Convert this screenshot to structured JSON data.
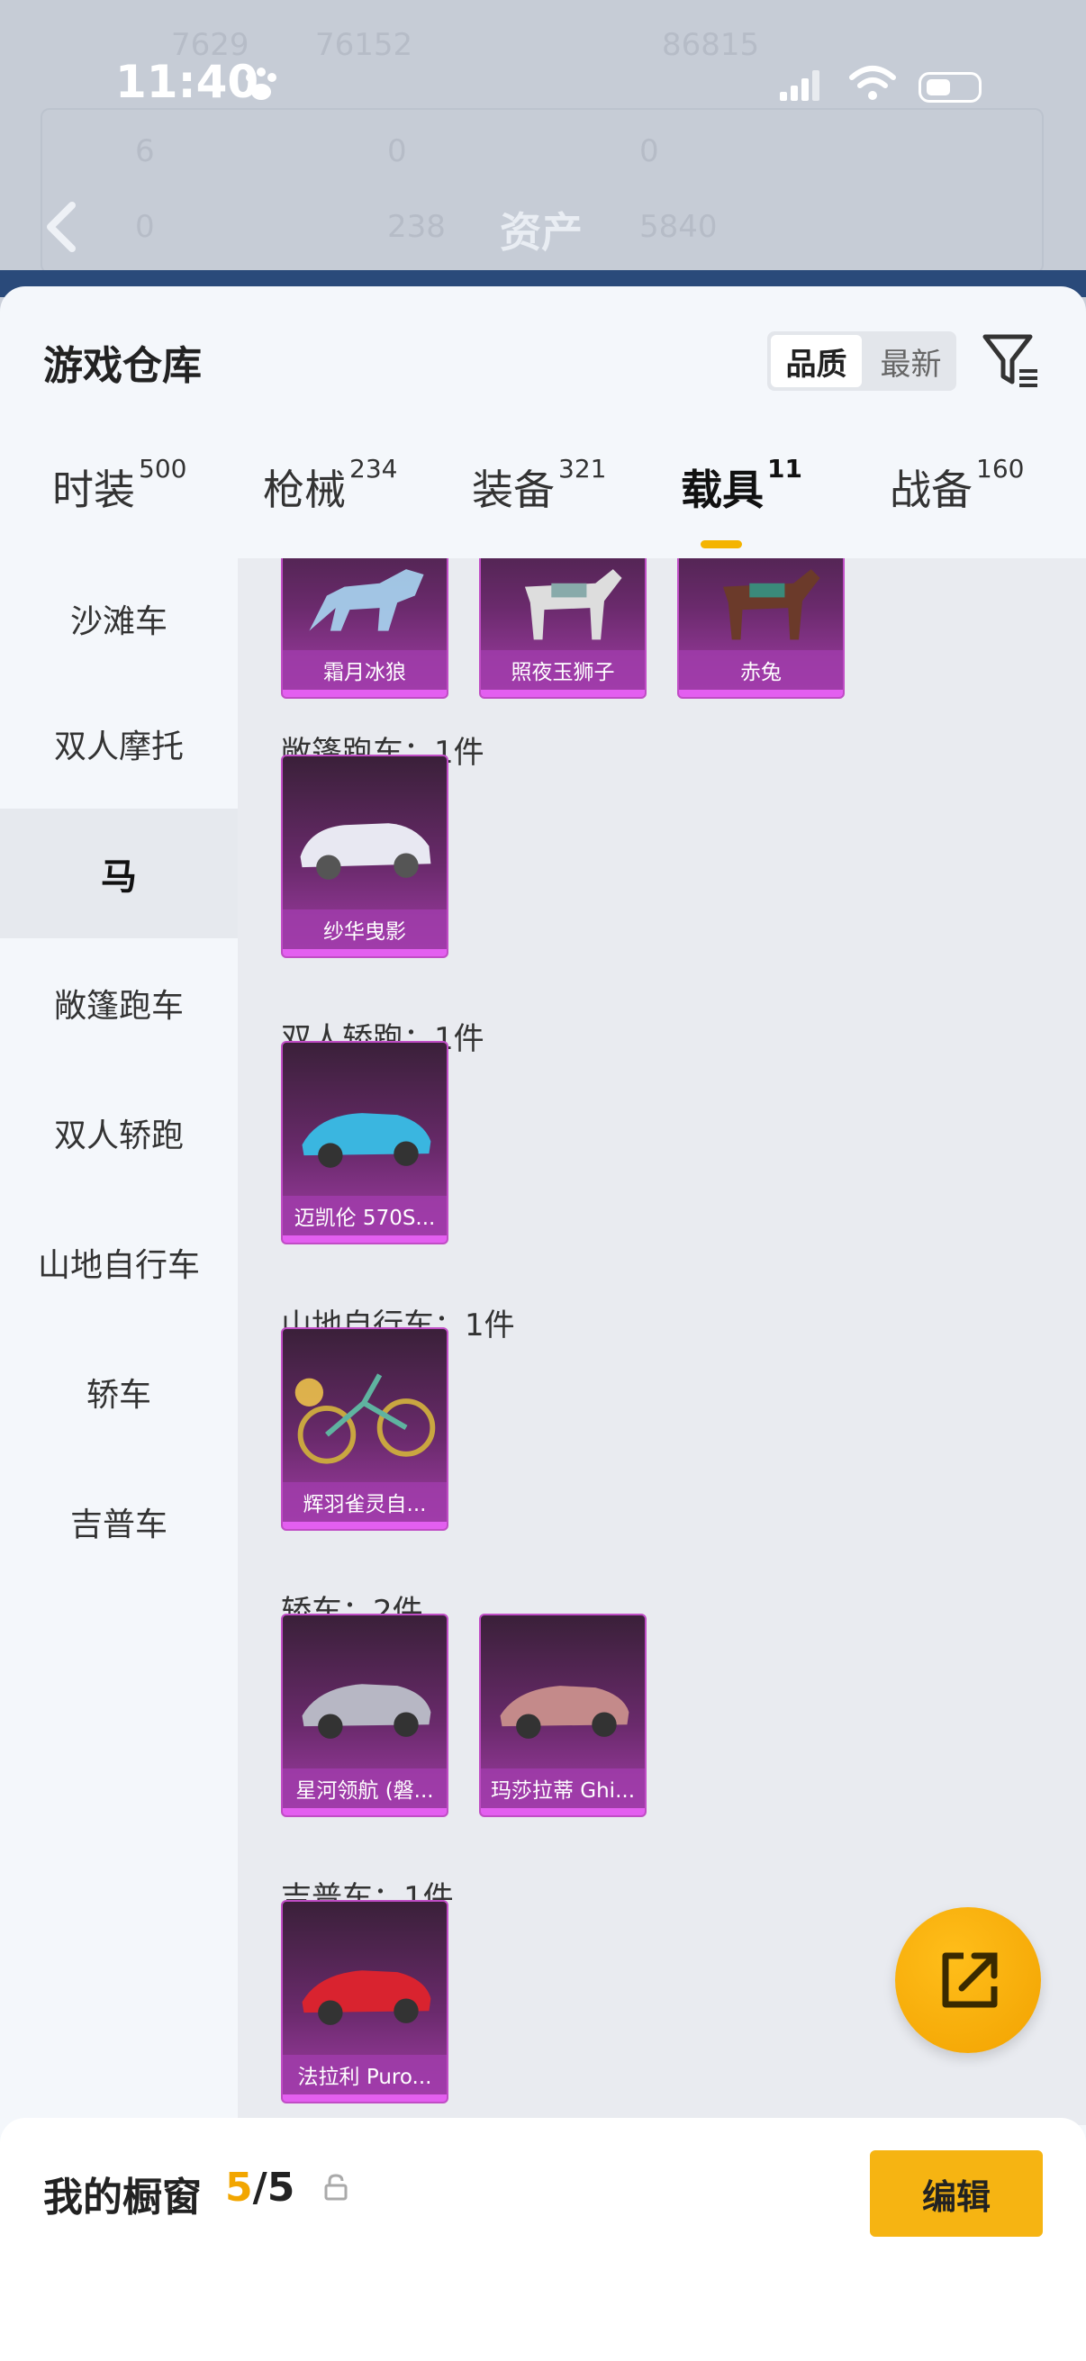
{
  "status_bar": {
    "time": "11:40"
  },
  "background_screen": {
    "title": "资产",
    "ghost_values": [
      "7629",
      "76152",
      "86815",
      "6",
      "0",
      "0",
      "0",
      "238",
      "5840"
    ]
  },
  "sheet": {
    "title": "游戏仓库",
    "sort_options": [
      "品质",
      "最新"
    ],
    "active_sort": "品质"
  },
  "tabs": [
    {
      "label": "时装",
      "count": "500"
    },
    {
      "label": "枪械",
      "count": "234"
    },
    {
      "label": "装备",
      "count": "321"
    },
    {
      "label": "载具",
      "count": "11"
    },
    {
      "label": "战备",
      "count": "160"
    }
  ],
  "active_tab": "载具",
  "sidebar": {
    "items": [
      "沙滩车",
      "双人摩托",
      "马",
      "敞篷跑车",
      "双人轿跑",
      "山地自行车",
      "轿车",
      "吉普车"
    ],
    "active": "马"
  },
  "content": {
    "top_row": [
      "霜月冰狼",
      "照夜玉狮子",
      "赤兔"
    ],
    "sections": [
      {
        "title": "敞篷跑车：1件",
        "items": [
          "纱华曳影"
        ]
      },
      {
        "title": "双人轿跑：1件",
        "items": [
          "迈凯伦 570S..."
        ]
      },
      {
        "title": "山地自行车：1件",
        "items": [
          "辉羽雀灵自..."
        ]
      },
      {
        "title": "轿车：2件",
        "items": [
          "星河领航 (磐...",
          "玛莎拉蒂 Ghi..."
        ]
      },
      {
        "title": "吉普车：1件",
        "items": [
          "法拉利 Puro..."
        ]
      }
    ]
  },
  "footer": {
    "label": "我的橱窗",
    "count_current": "5",
    "count_sep": "/",
    "count_total": "5",
    "edit_label": "编辑"
  },
  "colors": {
    "accent": "#f6b412",
    "card_purple": "#a43ea9"
  }
}
